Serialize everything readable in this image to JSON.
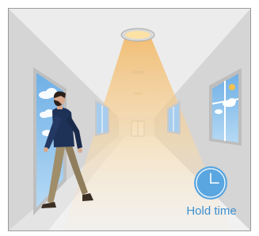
{
  "illustration": {
    "subject": "person-walking-in-corridor",
    "light": "ceiling-lamp-beam",
    "timer_icon": "clock-icon",
    "timer_label": "Hold time"
  },
  "colors": {
    "frame": "#9a9a9a",
    "wall": "#d6d6d6",
    "ceiling": "#ececec",
    "floor": "#f1f1f1",
    "beam": "#f5c680",
    "window": "#8fc2ea",
    "clock": "#5aa6e0",
    "label": "#3d8fd0",
    "jacket": "#1c2e52",
    "trousers": "#9d8a66"
  }
}
